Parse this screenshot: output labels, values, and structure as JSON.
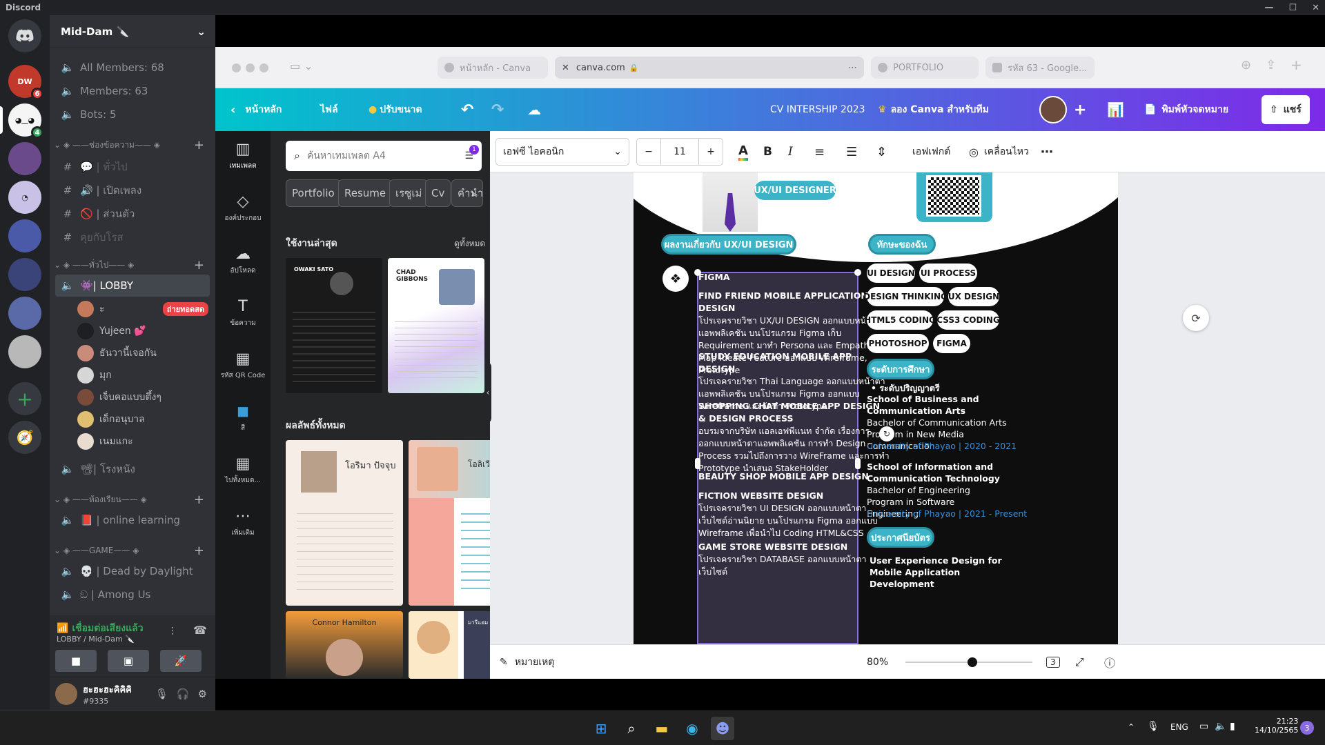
{
  "app_title": "Discord",
  "server": {
    "name": "Mid-Dam 🔪"
  },
  "stats": [
    "All Members: 68",
    "Members: 63",
    "Bots: 5"
  ],
  "categories": {
    "talk": "ช่องข้อความ",
    "general": "ทั่วไป",
    "classroom": "ห้องเรียน",
    "game": "GAME"
  },
  "text_channels": [
    "ทั่วไป",
    "เปิดเพลง",
    "ส่วนตัว",
    "คุยกับโรส"
  ],
  "voice_channels": {
    "lobby": "| LOBBY",
    "cinema": "| โรงหนัง",
    "online": "online learning",
    "dbd": "Dead by Daylight",
    "amongus": "Among Us"
  },
  "lobby_users": [
    {
      "name": "ะ",
      "live": "ถ่ายทอดสด",
      "color": "#c47a5a"
    },
    {
      "name": "Yujeen 💕",
      "color": "#2f3136"
    },
    {
      "name": "ธันวานี้เจอกัน",
      "color": "#c98b7a"
    },
    {
      "name": "มุก",
      "color": "#d6d6d6"
    },
    {
      "name": "เจ็บคอแบบตึ้งๆ",
      "color": "#7a4a3a"
    },
    {
      "name": "เด็กอนุบาล",
      "color": "#e0c070"
    },
    {
      "name": "เนมแกะ",
      "color": "#e8dcd0"
    }
  ],
  "voice_status": {
    "connected": "เชื่อมต่อเสียงแล้ว",
    "location": "LOBBY / Mid-Dam 🔪"
  },
  "user": {
    "name": "ฮะฮะฮะคิคิคิ",
    "tag": "#9335"
  },
  "rail_badges": {
    "b1": "6",
    "b2": "4"
  },
  "browser": {
    "tabs": [
      "หน้าหลัก - Canva",
      "canva.com",
      "PORTFOLIO",
      "รหัส 63 - Google..."
    ]
  },
  "canva": {
    "header": {
      "home": "หน้าหลัก",
      "file": "ไฟล์",
      "resize": "ปรับขนาด",
      "title": "CV INTERSHIP 2023",
      "team": "ลอง Canva สำหรับทีม",
      "print": "พิมพ์หัวจดหมาย",
      "share": "แชร์"
    },
    "tools": [
      "เทมเพลต",
      "องค์ประกอบ",
      "อัปโหลด",
      "ข้อความ",
      "รหัส QR Code",
      "สี",
      "ไปทั้งหมด...",
      "เพิ่มเติม"
    ],
    "search_placeholder": "ค้นหาเทมเพลต A4",
    "filter_badge": "1",
    "chips": [
      "Portfolio",
      "Resume",
      "เรซูเม่",
      "Cv",
      "คำนำ"
    ],
    "recent_title": "ใช้งานล่าสุด",
    "see_all": "ดูทั้งหมด",
    "all_results": "ผลลัพธ์ทั้งหมด",
    "thumbs": {
      "t1": "OWAKI SATO",
      "t2": "CHAD GIBBONS",
      "t3": "โอริมา ปัจจุบ",
      "t4": "โอลิเวีย วิลสัน",
      "t5": "Connor Hamilton",
      "t6": "มารีแอม หลัมโทสบ"
    },
    "format": {
      "font": "เอฟซี ไอคอนิก",
      "size": "11",
      "effects": "เอฟเฟกต์",
      "animate": "เคลื่อนไหว"
    },
    "footer": {
      "notes": "หมายเหตุ",
      "zoom": "80%",
      "pages": "3"
    }
  },
  "cv": {
    "role": "UX/UI DESIGNER",
    "portfolio_heading": "ผลงานเกี่ยวกับ UX/UI DESIGN",
    "skills_heading": "ทักษะของฉัน",
    "tool_label": "FIGMA",
    "projects": [
      {
        "title": "FIND FRIEND MOBILE APPLICATION DESIGN",
        "desc": "โปรเจครายวิชา UX/UI DESIGN ออกแบบหน้าตาแอพพลิเคชัน บนโปรแกรม Figma เก็บ Requirement มาทำ Persona และ Empathy Map Ideate Feature ออกแบบ Wireframe, Prototype"
      },
      {
        "title": "STUDY EDUCATION MOBILE APP DESIGN",
        "desc": "โปรเจครายวิชา Thai Language ออกแบบหน้าตาแอพพลิเคชัน บนโปรแกรม Figma ออกแบบ Wireframe และจัดทำ Prototype"
      },
      {
        "title": "SHOPPING CHAT MOBILE APP DESIGN & DESIGN PROCESS",
        "desc": "อบรมจากบริษัท แอลเอฟพีแนท จำกัด เรื่องการออกแบบหน้าตาแอพพลิเคชัน การทำ Design Process รวมไปถึงการวาง WireFrame และการทำ Prototype นำเสนอ StakeHolder"
      },
      {
        "title": "BEAUTY SHOP MOBILE APP DESIGN",
        "desc": ""
      },
      {
        "title": "FICTION WEBSITE DESIGN",
        "desc": "โปรเจครายวิชา UI DESIGN ออกแบบหน้าตาเว็บไซต์อ่านนิยาย บนโปรแกรม Figma ออกแบบ Wireframe เพื่อนำไป Coding HTML&CSS"
      },
      {
        "title": "GAME STORE WEBSITE DESIGN",
        "desc": "โปรเจครายวิชา DATABASE ออกแบบหน้าตาเว็บไซต์"
      }
    ],
    "skills": [
      "UI DESIGN",
      "UI PROCESS",
      "DESIGN THINKING",
      "UX DESIGN",
      "HTML5 CODING",
      "CSS3 CODING",
      "PHOTOSHOP",
      "FIGMA"
    ],
    "education_heading": "ระดับการศึกษา",
    "degree_level": "ระดับปริญญาตรี",
    "edu1": {
      "school": "School of Business and Communication Arts",
      "program": "Bachelor of Communication Arts Program in New Media Communication",
      "uni": "University of Phayao | 2020 - 2021"
    },
    "edu2": {
      "school": "School of Information and Communication Technology",
      "program": "Bachelor of Engineering Program in Software Engineering",
      "uni": "University of Phayao | 2021 - Present"
    },
    "cert_heading": "ประกาศนียบัตร",
    "cert1": "User Experience Design for Mobile Application Development"
  },
  "taskbar": {
    "lang": "ENG",
    "time": "21:23",
    "date": "14/10/2565",
    "notif": "3"
  }
}
